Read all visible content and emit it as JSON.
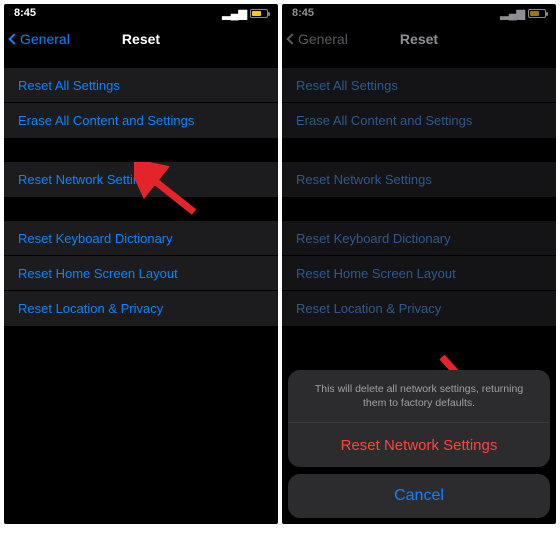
{
  "statusbar": {
    "time": "8:45"
  },
  "nav": {
    "back": "General",
    "title": "Reset"
  },
  "group1": {
    "row0": "Reset All Settings",
    "row1": "Erase All Content and Settings"
  },
  "group2": {
    "row0": "Reset Network Settings"
  },
  "group3": {
    "row0": "Reset Keyboard Dictionary",
    "row1": "Reset Home Screen Layout",
    "row2": "Reset Location & Privacy"
  },
  "sheet": {
    "message": "This will delete all network settings, returning them to factory defaults.",
    "action": "Reset Network Settings",
    "cancel": "Cancel"
  }
}
